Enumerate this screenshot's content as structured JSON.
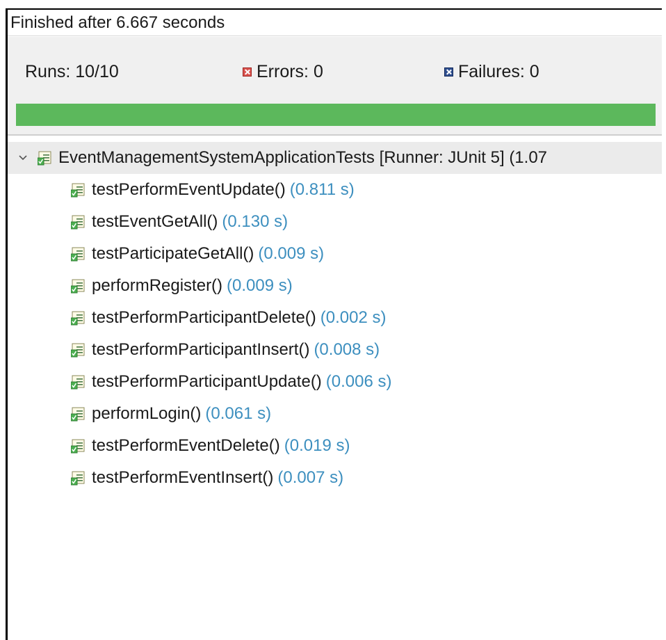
{
  "status": {
    "message": "Finished after 6.667 seconds"
  },
  "counters": {
    "runs": "Runs:  10/10",
    "errors": "Errors:  0",
    "failures": "Failures:  0"
  },
  "progress": {
    "fraction": 1.0,
    "color": "#5cb85c",
    "label": "all passed"
  },
  "tree": {
    "root": {
      "label": "EventManagementSystemApplicationTests [Runner: JUnit 5] (1.07",
      "icon": "test-suite-icon",
      "expanded": true
    },
    "tests": [
      {
        "name": "testPerformEventUpdate()",
        "time": "(0.811 s)",
        "icon": "test-passed-icon"
      },
      {
        "name": "testEventGetAll()",
        "time": "(0.130 s)",
        "icon": "test-passed-icon"
      },
      {
        "name": "testParticipateGetAll()",
        "time": "(0.009 s)",
        "icon": "test-passed-icon"
      },
      {
        "name": "performRegister()",
        "time": "(0.009 s)",
        "icon": "test-passed-icon"
      },
      {
        "name": "testPerformParticipantDelete()",
        "time": "(0.002 s)",
        "icon": "test-passed-icon"
      },
      {
        "name": "testPerformParticipantInsert()",
        "time": "(0.008 s)",
        "icon": "test-passed-icon"
      },
      {
        "name": "testPerformParticipantUpdate()",
        "time": "(0.006 s)",
        "icon": "test-passed-icon"
      },
      {
        "name": "performLogin()",
        "time": "(0.061 s)",
        "icon": "test-passed-icon"
      },
      {
        "name": "testPerformEventDelete()",
        "time": "(0.019 s)",
        "icon": "test-passed-icon"
      },
      {
        "name": "testPerformEventInsert()",
        "time": "(0.007 s)",
        "icon": "test-passed-icon"
      }
    ]
  },
  "colors": {
    "duration": "#3d8fbf",
    "error_icon": "#d9534f",
    "failure_icon": "#2f4f8f",
    "progress_track": "#e3e3e3"
  }
}
